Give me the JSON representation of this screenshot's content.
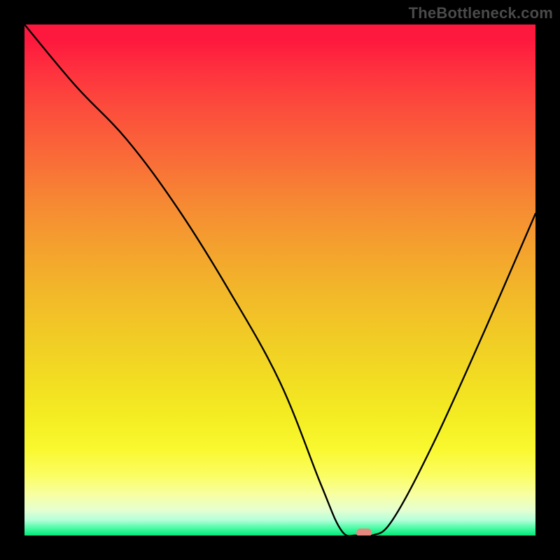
{
  "watermark": "TheBottleneck.com",
  "chart_data": {
    "type": "line",
    "title": "",
    "xlabel": "",
    "ylabel": "",
    "xlim": [
      0,
      100
    ],
    "ylim": [
      0,
      100
    ],
    "series": [
      {
        "name": "curve",
        "x": [
          0,
          10,
          20,
          30,
          40,
          50,
          58,
          62,
          65,
          68,
          72,
          80,
          90,
          100
        ],
        "y": [
          100,
          88,
          77.5,
          64,
          48,
          30,
          10,
          1,
          0,
          0,
          3,
          18,
          40,
          63
        ]
      }
    ],
    "annotations": [
      {
        "name": "optimal-marker",
        "x": 66.5,
        "y": 0.5
      }
    ],
    "grid": false,
    "legend": false
  },
  "colors": {
    "curve": "#000000",
    "marker": "#e5887e",
    "background_black": "#000000"
  }
}
